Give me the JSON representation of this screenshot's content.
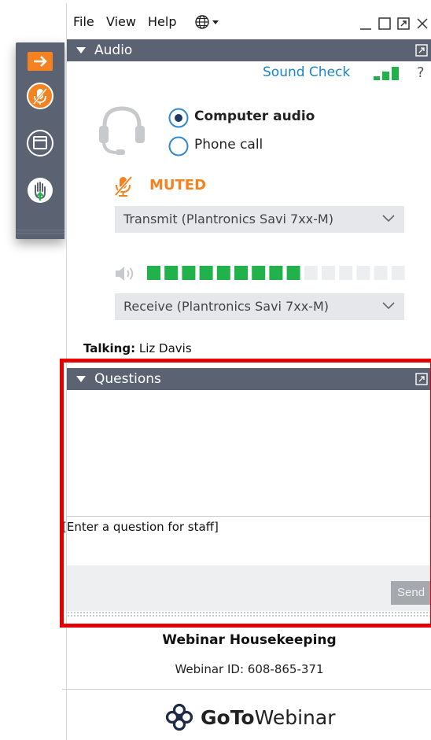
{
  "menubar": {
    "items": [
      "File",
      "View",
      "Help"
    ]
  },
  "audio": {
    "header": "Audio",
    "sound_check": "Sound Check",
    "help": "?",
    "options": [
      "Computer audio",
      "Phone call"
    ],
    "selected_option": "Computer audio",
    "mute_status": "MUTED",
    "transmit_device": "Transmit (Plantronics Savi 7xx-M)",
    "receive_device": "Receive (Plantronics Savi 7xx-M)",
    "volume_level": 0.6,
    "signal_bars_level": 3
  },
  "talking": {
    "label": "Talking:",
    "name": "Liz Davis"
  },
  "questions": {
    "header": "Questions",
    "input_placeholder": "[Enter a question for staff]",
    "send_label": "Send"
  },
  "webinar": {
    "title": "Webinar Housekeeping",
    "id_line": "Webinar ID: 608-865-371"
  },
  "brand": {
    "bold": "GoTo",
    "regular": "Webinar"
  },
  "colors": {
    "accent": "#f58220",
    "header_bg": "#5b6372",
    "link": "#1a86c8",
    "meter_on": "#21b24b",
    "highlight": "#e50000"
  }
}
